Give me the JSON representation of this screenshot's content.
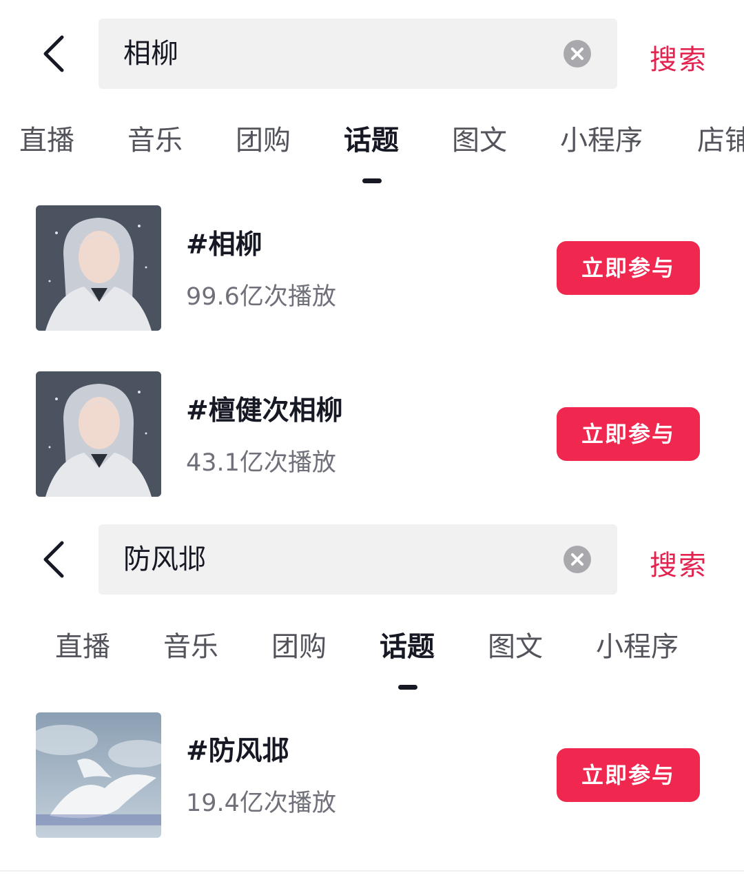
{
  "screens": [
    {
      "search": {
        "query": "相柳",
        "action_label": "搜索"
      },
      "tabs": [
        "直播",
        "音乐",
        "团购",
        "话题",
        "图文",
        "小程序",
        "店铺"
      ],
      "active_tab": "话题",
      "results": [
        {
          "title": "#相柳",
          "plays": "99.6亿次播放",
          "button": "立即参与",
          "thumb_icon": "portrait-icon"
        },
        {
          "title": "#檀健次相柳",
          "plays": "43.1亿次播放",
          "button": "立即参与",
          "thumb_icon": "portrait-icon"
        }
      ]
    },
    {
      "search": {
        "query": "防风邶",
        "action_label": "搜索"
      },
      "tabs": [
        "直播",
        "音乐",
        "团购",
        "话题",
        "图文",
        "小程序"
      ],
      "active_tab": "话题",
      "results": [
        {
          "title": "#防风邶",
          "plays": "19.4亿次播放",
          "button": "立即参与",
          "thumb_icon": "white-bird-icon"
        }
      ]
    }
  ],
  "icons": {
    "back": "chevron-left-icon",
    "clear": "clear-icon"
  },
  "colors": {
    "accent": "#f0284f",
    "search_action": "#e3234f",
    "search_box": "#f1f1f2",
    "primary_text": "#161823",
    "secondary_text": "#6f7079"
  }
}
